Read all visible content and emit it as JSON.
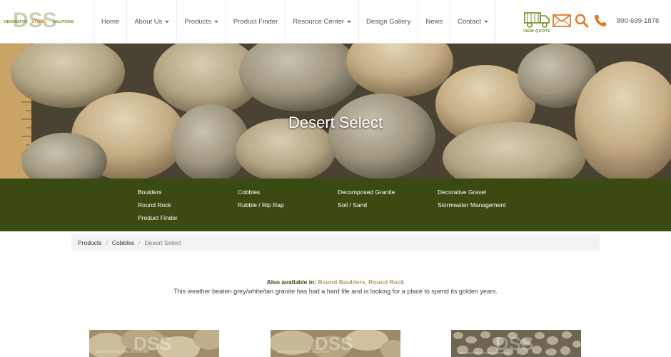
{
  "logo": {
    "letters": "DSS",
    "tagline_left": "DECORATIVE",
    "tagline_mid": "STONE",
    "tagline_right": "SOLUTIONS"
  },
  "nav": [
    {
      "label": "Home",
      "dropdown": false
    },
    {
      "label": "About Us",
      "dropdown": true
    },
    {
      "label": "Products",
      "dropdown": true
    },
    {
      "label": "Product Finder",
      "dropdown": false
    },
    {
      "label": "Resource Center",
      "dropdown": true
    },
    {
      "label": "Design Gallery",
      "dropdown": false
    },
    {
      "label": "News",
      "dropdown": false
    },
    {
      "label": "Contact",
      "dropdown": true
    }
  ],
  "header": {
    "view_quote_label": "VIEW QUOTE",
    "phone": "800-699-1878",
    "icons": [
      "truck-icon",
      "mail-icon",
      "search-icon",
      "phone-icon"
    ]
  },
  "hero": {
    "title": "Desert Select"
  },
  "categories": {
    "col1": [
      "Boulders",
      "Round Rock",
      "Product Finder"
    ],
    "col2": [
      "Cobbles",
      "Rubble / Rip Rap"
    ],
    "col3": [
      "Decomposed Granite",
      "Soil / Sand"
    ],
    "col4": [
      "Decorative Gravel",
      "Stormwater Management"
    ]
  },
  "breadcrumb": {
    "items": [
      "Products",
      "Cobbles"
    ],
    "current": "Desert Select"
  },
  "product": {
    "also_available_label": "Also available in:",
    "also_available_links": "Round Boulders, Round Rock",
    "description": "This weather beaten grey/white/tan granite has had a hard life and is looking for a place to spend its golden years."
  },
  "thumbnails": {
    "watermark": "DSS",
    "watermark_tagline": "DECORATIVE STONE SOLUTIONS"
  },
  "colors": {
    "brand_green": "#3b4a12",
    "accent_orange": "#e07b22",
    "logo_green": "#6b8e23",
    "link_tan": "#b09a6c"
  }
}
